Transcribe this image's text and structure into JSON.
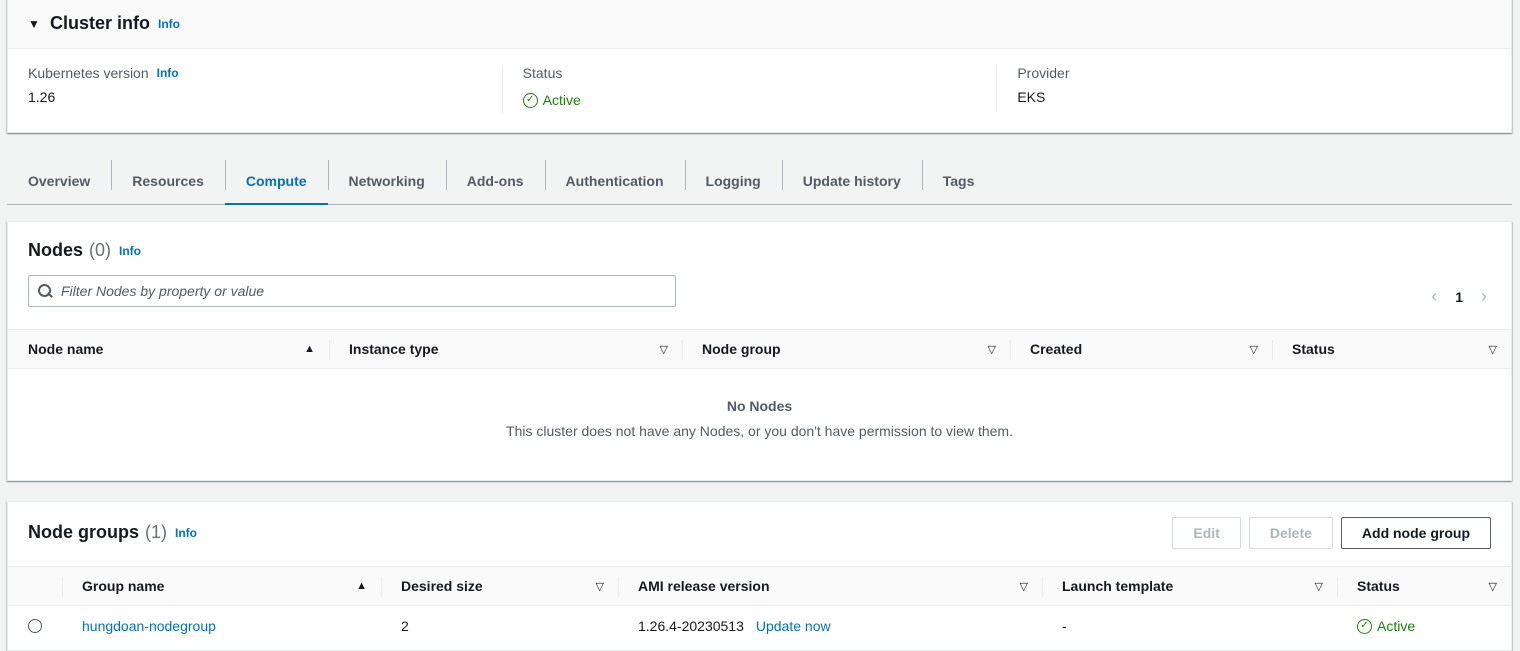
{
  "cluster_info": {
    "title": "Cluster info",
    "info": "Info",
    "kubernetes_version_label": "Kubernetes version",
    "kubernetes_version_info": "Info",
    "kubernetes_version": "1.26",
    "status_label": "Status",
    "status": "Active",
    "provider_label": "Provider",
    "provider": "EKS"
  },
  "tabs": [
    "Overview",
    "Resources",
    "Compute",
    "Networking",
    "Add-ons",
    "Authentication",
    "Logging",
    "Update history",
    "Tags"
  ],
  "active_tab": "Compute",
  "nodes": {
    "title": "Nodes",
    "count": "(0)",
    "info": "Info",
    "filter_placeholder": "Filter Nodes by property or value",
    "page": "1",
    "columns": [
      "Node name",
      "Instance type",
      "Node group",
      "Created",
      "Status"
    ],
    "empty_title": "No Nodes",
    "empty_description": "This cluster does not have any Nodes, or you don't have permission to view them."
  },
  "node_groups": {
    "title": "Node groups",
    "count": "(1)",
    "info": "Info",
    "edit_label": "Edit",
    "delete_label": "Delete",
    "add_label": "Add node group",
    "columns": [
      "Group name",
      "Desired size",
      "AMI release version",
      "Launch template",
      "Status"
    ],
    "rows": [
      {
        "group_name": "hungdoan-nodegroup",
        "desired_size": "2",
        "ami_release_version": "1.26.4-20230513",
        "update_link": "Update now",
        "launch_template": "-",
        "status": "Active"
      }
    ]
  },
  "colors": {
    "link": "#0073bb",
    "success": "#1d8102",
    "border": "#eaeded"
  }
}
